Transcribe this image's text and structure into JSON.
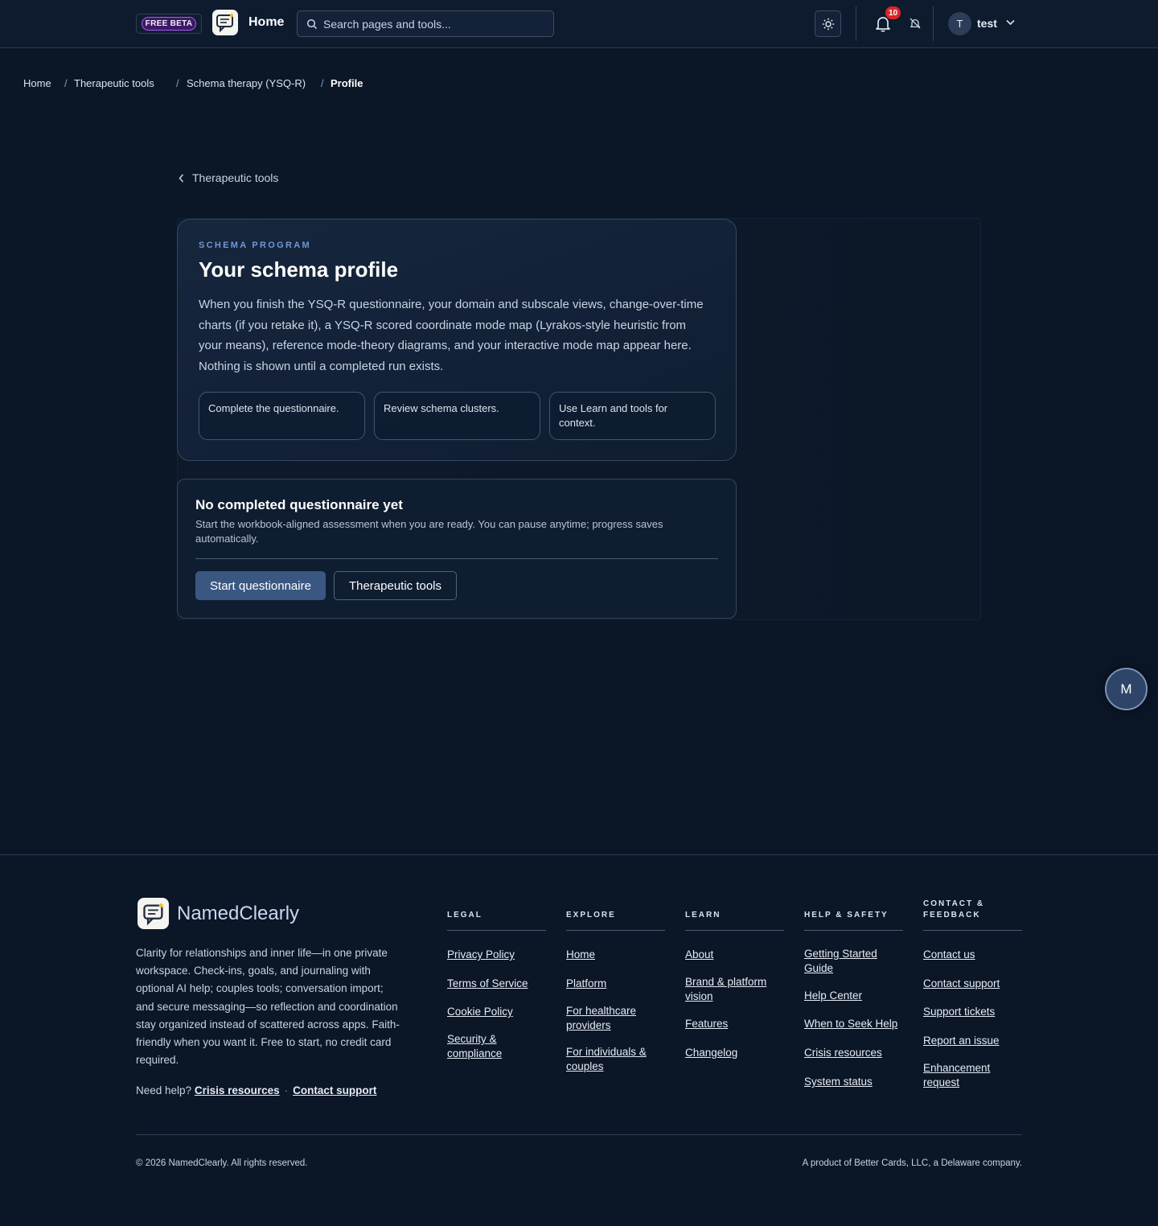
{
  "header": {
    "beta_label": "FREE BETA",
    "home_label": "Home",
    "search_placeholder": "Search pages and tools...",
    "notification_count": "10",
    "user_initial": "T",
    "user_name": "test"
  },
  "breadcrumb": [
    {
      "label": "Home"
    },
    {
      "label": "Therapeutic tools"
    },
    {
      "label": "Schema therapy (YSQ-R)"
    },
    {
      "label": "Profile"
    }
  ],
  "breadcrumb_separator": "/",
  "back_link": "Therapeutic tools",
  "profile_card": {
    "eyebrow": "SCHEMA PROGRAM",
    "title": "Your schema profile",
    "description": "When you finish the YSQ-R questionnaire, your domain and subscale views, change-over-time charts (if you retake it), a YSQ-R scored coordinate mode map (Lyrakos-style heuristic from your means), reference mode-theory diagrams, and your interactive mode map appear here. Nothing is shown until a completed run exists.",
    "chips": [
      "Complete the questionnaire.",
      "Review schema clusters.",
      "Use Learn and tools for context."
    ]
  },
  "status_card": {
    "title": "No completed questionnaire yet",
    "body": "Start the workbook-aligned assessment when you are ready. You can pause anytime; progress saves automatically.",
    "primary_button": "Start questionnaire",
    "secondary_button": "Therapeutic tools"
  },
  "fab_label": "M",
  "footer": {
    "brand": "NamedClearly",
    "blurb": "Clarity for relationships and inner life—in one private workspace. Check-ins, goals, and journaling with optional AI help; couples tools; conversation import; and secure messaging—so reflection and coordination stay organized instead of scattered across apps. Faith-friendly when you want it. Free to start, no credit card required.",
    "help_prefix": "Need help?",
    "help_link_1": "Crisis resources",
    "help_dot": "·",
    "help_link_2": "Contact support",
    "columns": [
      {
        "heading": "LEGAL",
        "links": [
          "Privacy Policy",
          "Terms of Service",
          "Cookie Policy",
          "Security & compliance"
        ]
      },
      {
        "heading": "EXPLORE",
        "links": [
          "Home",
          "Platform",
          "For healthcare providers",
          "For individuals & couples"
        ]
      },
      {
        "heading": "LEARN",
        "links": [
          "About",
          "Brand & platform vision",
          "Features",
          "Changelog"
        ]
      },
      {
        "heading": "HELP & SAFETY",
        "links": [
          "Getting Started Guide",
          "Help Center",
          "When to Seek Help",
          "Crisis resources",
          "System status"
        ]
      },
      {
        "heading": "CONTACT & FEEDBACK",
        "links": [
          "Contact us",
          "Contact support",
          "Support tickets",
          "Report an issue",
          "Enhancement request"
        ]
      }
    ],
    "copyright": "© 2026 NamedClearly. All rights reserved.",
    "product_line": "A product of Better Cards, LLC, a Delaware company."
  },
  "colors": {
    "background": "#0b1626",
    "accent_button": "#3a5782",
    "eyebrow": "#6f98d6",
    "badge": "#dc2626",
    "beta_badge": "#a855f7"
  },
  "icons": [
    "logo-icon",
    "search-icon",
    "sun-icon",
    "bell-icon",
    "bell-off-icon",
    "chevron-down-icon",
    "chevron-left-icon"
  ]
}
